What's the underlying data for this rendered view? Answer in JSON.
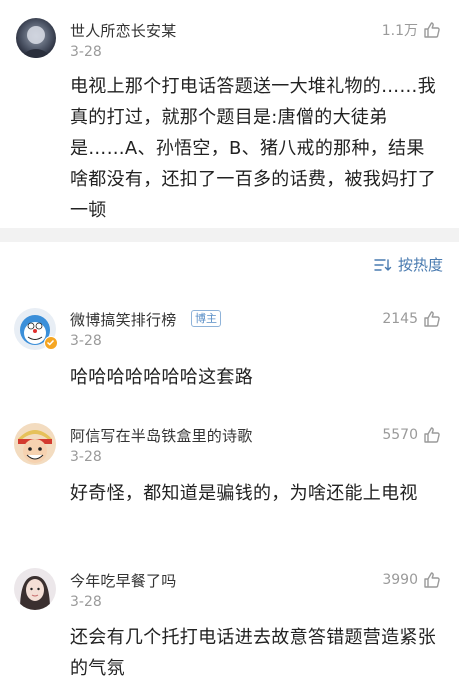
{
  "post": {
    "author": "世人所恋长安某",
    "date": "3-28",
    "likes": "1.1万",
    "text": "电视上那个打电话答题送一大堆礼物的……我真的打过，就那个题目是:唐僧的大徒弟是……A、孙悟空，B、猪八戒的那种，结果啥都没有，还扣了一百多的话费，被我妈打了一顿"
  },
  "sort": {
    "label": "按热度",
    "icon": "sort-icon"
  },
  "comments": [
    {
      "author": "微博搞笑排行榜",
      "badge": "博主",
      "date": "3-28",
      "likes": "2145",
      "text": "哈哈哈哈哈哈哈这套路"
    },
    {
      "author": "阿信写在半岛铁盒里的诗歌",
      "date": "3-28",
      "likes": "5570",
      "text": "好奇怪，都知道是骗钱的，为啥还能上电视"
    },
    {
      "author": "今年吃早餐了吗",
      "date": "3-28",
      "likes": "3990",
      "text": "还会有几个托打电话进去故意答错题营造紧张的气氛"
    }
  ],
  "colors": {
    "accent": "#4a7bb0",
    "muted": "#9a9a9a",
    "divider": "#f2f2f2"
  }
}
